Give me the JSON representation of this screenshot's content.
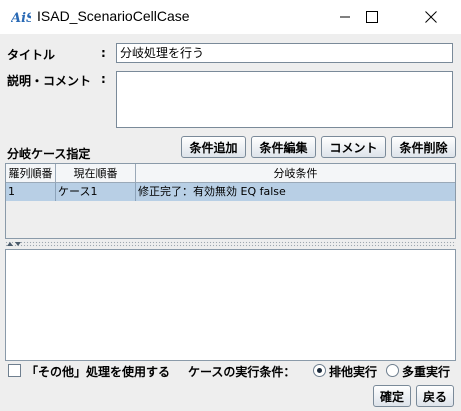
{
  "window": {
    "title": "ISAD_ScenarioCellCase",
    "icon": "app-logo-icon"
  },
  "form": {
    "title_label": "タイトル",
    "title_colon": ":",
    "title_value": "分岐処理を行う",
    "comment_label": "説明・コメント",
    "comment_colon": ":",
    "comment_value": ""
  },
  "cases": {
    "section_label": "分岐ケース指定",
    "buttons": {
      "add": "条件追加",
      "edit": "条件編集",
      "comment": "コメント",
      "delete": "条件削除"
    },
    "columns": [
      "羅列順番",
      "現在順番",
      "分岐条件"
    ],
    "rows": [
      {
        "order": "1",
        "current": "ケース1",
        "condition": "修正完了：有効無効 EQ false"
      }
    ]
  },
  "options": {
    "use_other_label": "「その他」処理を使用する",
    "use_other_checked": false,
    "exec_condition_label": "ケースの実行条件：",
    "radio_exclusive": "排他実行",
    "radio_multiple": "多重実行",
    "selected": "排他実行"
  },
  "footer": {
    "ok": "確定",
    "back": "戻る"
  },
  "colors": {
    "selection": "#b8cfe5",
    "panel": "#eeeeee",
    "logo": "#2a6ab5"
  }
}
